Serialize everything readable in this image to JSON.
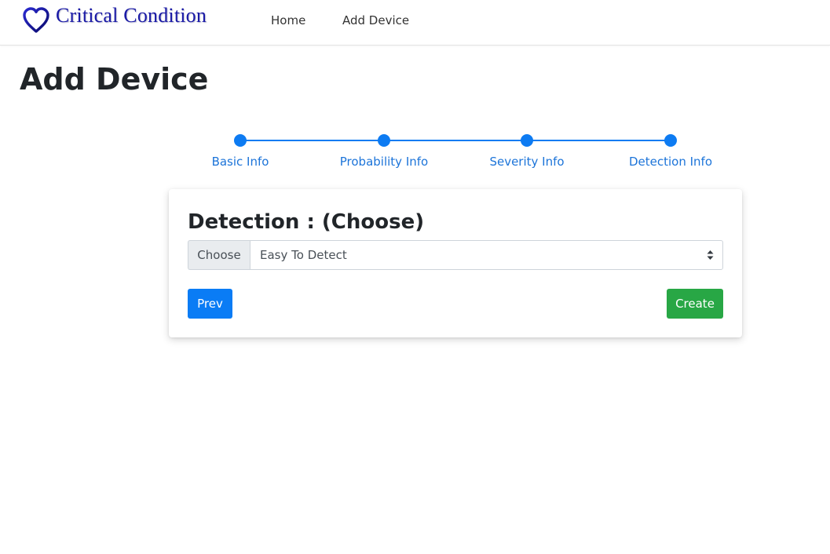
{
  "navbar": {
    "brand_name": "Critical Condition",
    "brand_icon": "heart-icon",
    "links": [
      {
        "label": "Home"
      },
      {
        "label": "Add Device"
      }
    ]
  },
  "page": {
    "title": "Add Device"
  },
  "stepper": {
    "steps": [
      {
        "label": "Basic Info"
      },
      {
        "label": "Probability Info"
      },
      {
        "label": "Severity Info"
      },
      {
        "label": "Detection Info"
      }
    ]
  },
  "form": {
    "title": "Detection : (Choose)",
    "prepend_label": "Choose",
    "selected_value": "Easy To Detect",
    "prev_label": "Prev",
    "create_label": "Create"
  },
  "colors": {
    "accent": "#0d7bf2",
    "success": "#28a745",
    "brand": "#1a1aa6"
  }
}
